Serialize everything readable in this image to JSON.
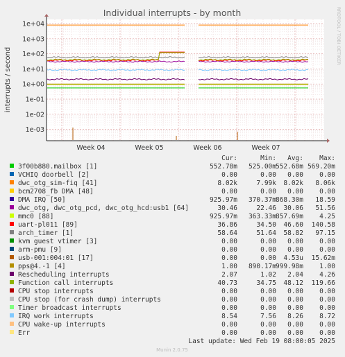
{
  "chart_data": {
    "type": "line",
    "title": "Individual interrupts - by month",
    "ylabel": "interrupts / second",
    "y_scale": "log",
    "ylim": [
      0.0003,
      20000
    ],
    "y_ticks": [
      "1e+04",
      "1e+03",
      "1e+02",
      "1e+01",
      "1e+00",
      "1e-01",
      "1e-02",
      "1e-03"
    ],
    "x_ticks": [
      "Week 04",
      "Week 05",
      "Week 06",
      "Week 07"
    ],
    "side_label": "RRDTOOL / TOBI OETIKER",
    "grid": true,
    "gaps": [
      "Week 05 end",
      "Week 06 start"
    ],
    "columns": [
      "Cur:",
      "Min:",
      "Avg:",
      "Max:"
    ],
    "series": [
      {
        "name": "3f00b880.mailbox [1]",
        "color": "#00cc00",
        "level": 0.55,
        "cur": "552.78m",
        "min": "525.00m",
        "avg": "552.68m",
        "max": "569.20m"
      },
      {
        "name": "VCHIQ doorbell [2]",
        "color": "#0066b3",
        "level": 0,
        "cur": "0.00",
        "min": "0.00",
        "avg": "0.00",
        "max": "0.00"
      },
      {
        "name": "dwc_otg_sim-fiq [41]",
        "color": "#ff8000",
        "level": 8020,
        "cur": "8.02k",
        "min": "7.99k",
        "avg": "8.02k",
        "max": "8.06k"
      },
      {
        "name": "bcm2708_fb DMA [48]",
        "color": "#ffcc00",
        "level": 0,
        "cur": "0.00",
        "min": "0.00",
        "avg": "0.00",
        "max": "0.00"
      },
      {
        "name": "DMA IRQ [50]",
        "color": "#330099",
        "level": 0.93,
        "cur": "925.97m",
        "min": "370.37m",
        "avg": "868.30m",
        "max": "18.59"
      },
      {
        "name": "dwc_otg, dwc_otg_pcd, dwc_otg_hcd:usb1 [64]",
        "color": "#990099",
        "level": 30.5,
        "cur": "30.46",
        "min": "22.46",
        "avg": "30.06",
        "max": "51.56"
      },
      {
        "name": "mmc0 [88]",
        "color": "#ccff00",
        "level": 0.93,
        "cur": "925.97m",
        "min": "363.33m",
        "avg": "857.69m",
        "max": "4.25"
      },
      {
        "name": "uart-pl011 [89]",
        "color": "#ff0000",
        "level": 36.86,
        "cur": "36.86",
        "min": "34.50",
        "avg": "46.60",
        "max": "140.58"
      },
      {
        "name": "arch_timer [1]",
        "color": "#808080",
        "level": 58.64,
        "cur": "58.64",
        "min": "51.64",
        "avg": "58.82",
        "max": "97.15"
      },
      {
        "name": "kvm guest vtimer [3]",
        "color": "#008f00",
        "level": 0,
        "cur": "0.00",
        "min": "0.00",
        "avg": "0.00",
        "max": "0.00"
      },
      {
        "name": "arm-pmu [9]",
        "color": "#00487d",
        "level": 0,
        "cur": "0.00",
        "min": "0.00",
        "avg": "0.00",
        "max": "0.00"
      },
      {
        "name": "usb-001:004:01 [17]",
        "color": "#b35a00",
        "level": 0,
        "cur": "0.00",
        "min": "0.00",
        "avg": "4.53u",
        "max": "15.62m"
      },
      {
        "name": "pps@4.-1 [4]",
        "color": "#b38f00",
        "level": 1.0,
        "cur": "1.00",
        "min": "890.17m",
        "avg": "999.98m",
        "max": "1.00"
      },
      {
        "name": "Rescheduling interrupts",
        "color": "#6b006b",
        "level": 2.07,
        "cur": "2.07",
        "min": "1.02",
        "avg": "2.04",
        "max": "4.26"
      },
      {
        "name": "Function call interrupts",
        "color": "#8fb300",
        "level": 40.73,
        "cur": "40.73",
        "min": "34.75",
        "avg": "48.12",
        "max": "119.66"
      },
      {
        "name": "CPU stop interrupts",
        "color": "#b30000",
        "level": 0,
        "cur": "0.00",
        "min": "0.00",
        "avg": "0.00",
        "max": "0.00"
      },
      {
        "name": "CPU stop (for crash dump) interrupts",
        "color": "#bebebe",
        "level": 0,
        "cur": "0.00",
        "min": "0.00",
        "avg": "0.00",
        "max": "0.00"
      },
      {
        "name": "Timer broadcast interrupts",
        "color": "#80ff80",
        "level": 0,
        "cur": "0.00",
        "min": "0.00",
        "avg": "0.00",
        "max": "0.00"
      },
      {
        "name": "IRQ work interrupts",
        "color": "#80c9ff",
        "level": 8.54,
        "cur": "8.54",
        "min": "7.56",
        "avg": "8.26",
        "max": "8.72"
      },
      {
        "name": "CPU wake-up interrupts",
        "color": "#ffc080",
        "level": 0,
        "cur": "0.00",
        "min": "0.00",
        "avg": "0.00",
        "max": "0.00"
      },
      {
        "name": "Err",
        "color": "#ffe680",
        "level": 0,
        "cur": "0.00",
        "min": "0.00",
        "avg": "0.00",
        "max": "0.00"
      }
    ],
    "footer": {
      "last_update": "Last update: Wed Feb 19 08:00:05 2025",
      "credit": "Munin 2.0.75"
    }
  }
}
